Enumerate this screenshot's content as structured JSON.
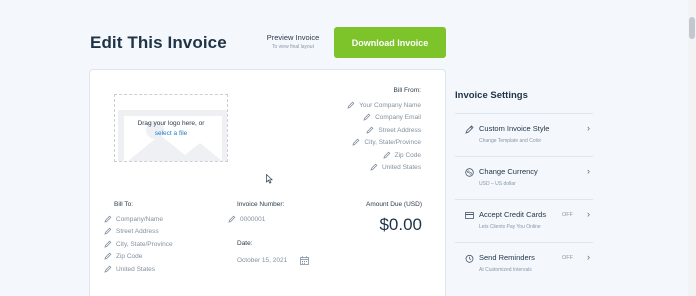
{
  "header": {
    "title": "Edit This Invoice",
    "preview_label": "Preview Invoice",
    "preview_sub": "To view final layout",
    "download_label": "Download Invoice"
  },
  "logo": {
    "line1": "Drag your logo here, or",
    "link": "select a file"
  },
  "bill_from": {
    "title": "Bill From:",
    "fields": [
      "Your Company Name",
      "Company Email",
      "Street Address",
      "City, State/Province",
      "Zip Code",
      "United States"
    ]
  },
  "bill_to": {
    "title": "Bill To:",
    "fields": [
      "Company/Name",
      "Street Address",
      "City, State/Province",
      "Zip Code",
      "United States"
    ]
  },
  "invoice_number": {
    "label": "Invoice Number:",
    "value": "0000001"
  },
  "date": {
    "label": "Date:",
    "value": "October 15, 2021"
  },
  "amount_due": {
    "label": "Amount Due (USD)",
    "value": "$0.00"
  },
  "sidebar": {
    "heading": "Invoice Settings",
    "items": [
      {
        "title": "Custom Invoice Style",
        "sub": "Change Template and Color",
        "status": ""
      },
      {
        "title": "Change Currency",
        "sub": "USD – US dollar",
        "status": ""
      },
      {
        "title": "Accept Credit Cards",
        "sub": "Lets Clients Pay You Online",
        "status": "OFF"
      },
      {
        "title": "Send Reminders",
        "sub": "At Customized Intervals",
        "status": "OFF"
      }
    ]
  },
  "colors": {
    "accent_green": "#7dc42b",
    "link_blue": "#1e7fc4",
    "heading_dark": "#1f3347"
  }
}
